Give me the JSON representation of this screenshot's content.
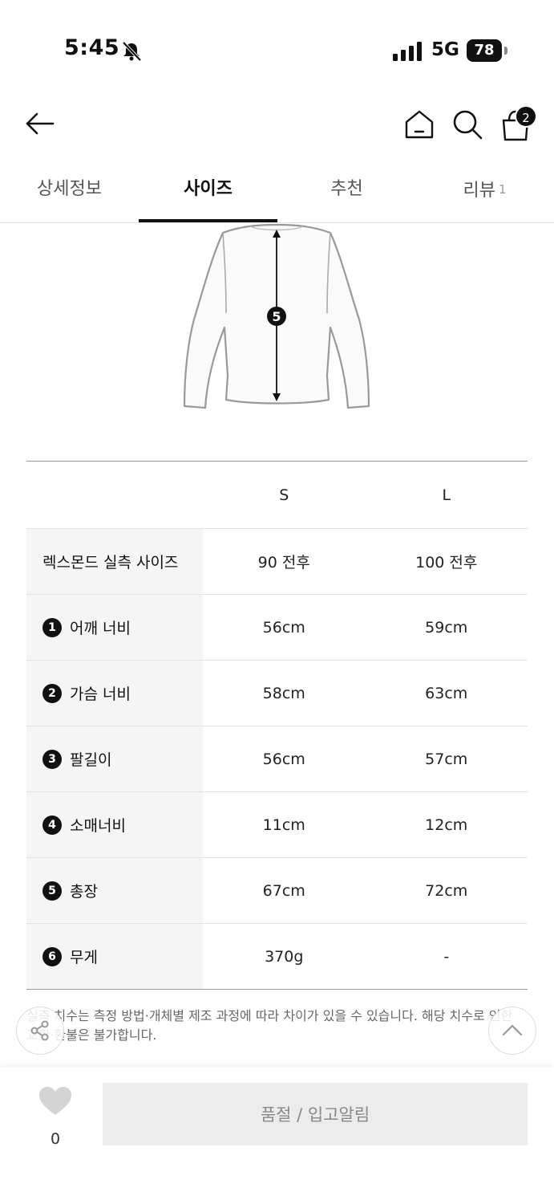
{
  "status_bar": {
    "time": "5:45",
    "network": "5G",
    "battery": "78"
  },
  "header": {
    "cart_count": "2"
  },
  "tabs": [
    {
      "label": "상세정보",
      "active": false
    },
    {
      "label": "사이즈",
      "active": true
    },
    {
      "label": "추천",
      "active": false
    },
    {
      "label": "리뷰",
      "count": "1",
      "active": false
    }
  ],
  "diagram": {
    "marker": "5"
  },
  "size_table": {
    "columns": [
      "S",
      "L"
    ],
    "rows": [
      {
        "badge": "",
        "label": "렉스몬드 실측 사이즈",
        "values": [
          "90 전후",
          "100 전후"
        ]
      },
      {
        "badge": "1",
        "label": "어깨 너비",
        "values": [
          "56cm",
          "59cm"
        ]
      },
      {
        "badge": "2",
        "label": "가슴 너비",
        "values": [
          "58cm",
          "63cm"
        ]
      },
      {
        "badge": "3",
        "label": "팔길이",
        "values": [
          "56cm",
          "57cm"
        ]
      },
      {
        "badge": "4",
        "label": "소매너비",
        "values": [
          "11cm",
          "12cm"
        ]
      },
      {
        "badge": "5",
        "label": "총장",
        "values": [
          "67cm",
          "72cm"
        ]
      },
      {
        "badge": "6",
        "label": "무게",
        "values": [
          "370g",
          "-"
        ]
      }
    ]
  },
  "notice": "실측 치수는 측정 방법·개체별 제조 과정에 따라 차이가 있을 수 있습니다. 해당 치수로 인한 교환·환불은 불가합니다.",
  "bottom_bar": {
    "like_count": "0",
    "cta_label": "품절 / 입고알림"
  },
  "colors": {
    "text": "#111111",
    "muted": "#888888",
    "label_bg": "#f5f5f5",
    "cta_bg": "#ececec"
  }
}
